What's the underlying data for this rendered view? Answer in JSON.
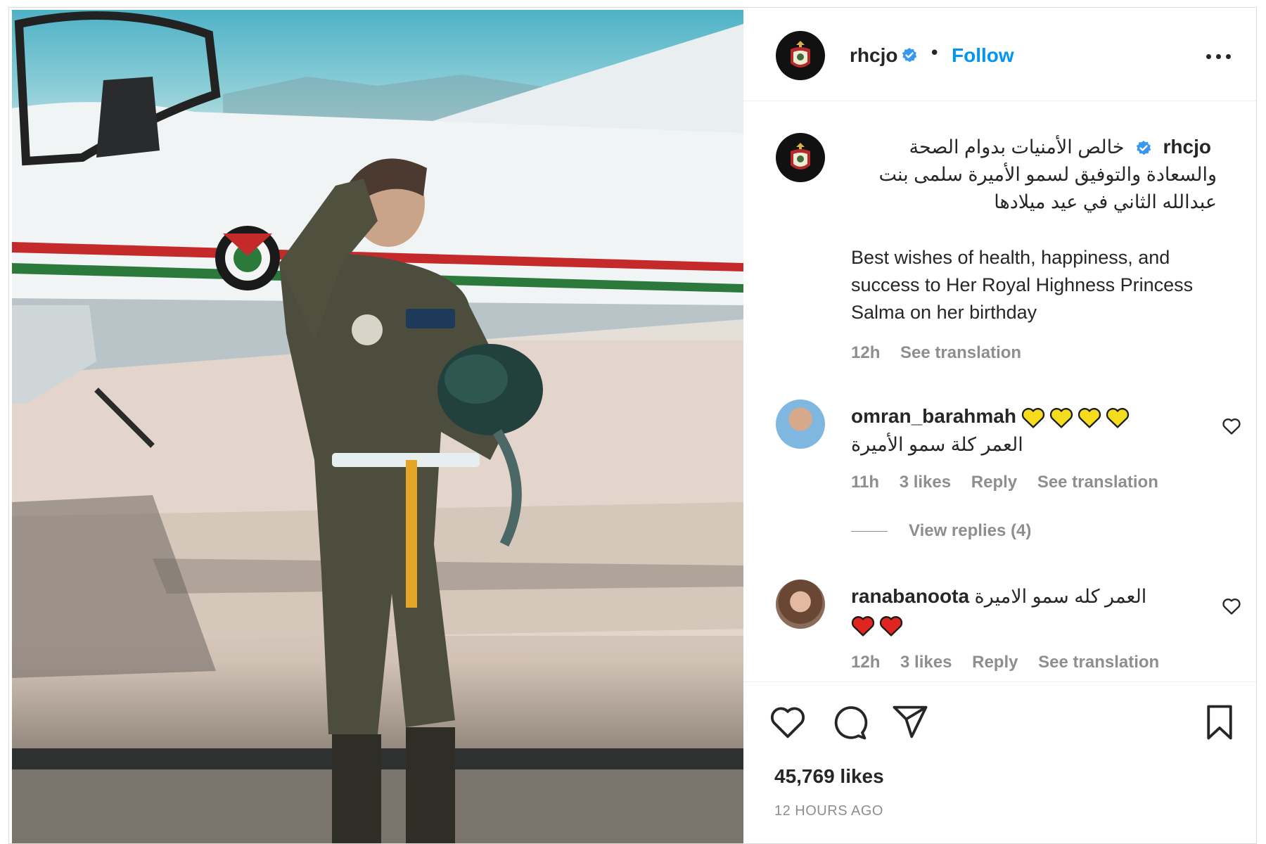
{
  "post": {
    "username": "rhcjo",
    "follow_label": "Follow",
    "separator": "•"
  },
  "caption": {
    "username": "rhcjo",
    "arabic": "خالص الأمنيات بدوام الصحة والسعادة والتوفيق لسمو الأميرة سلمى بنت عبدالله الثاني في عيد ميلادها",
    "english": "Best wishes of health, happiness, and success to Her Royal Highness Princess Salma on her birthday",
    "time": "12h",
    "see_translation": "See translation"
  },
  "comments": [
    {
      "username": "omran_barahmah",
      "text": "العمر كلة سمو الأميرة",
      "emoji_hearts": 4,
      "emoji_color": "#f5dc1f",
      "time": "11h",
      "likes": "3 likes",
      "reply": "Reply",
      "see_translation": "See translation"
    },
    {
      "username": "ranabanoota",
      "text": "العمر كله سمو الاميرة",
      "emoji_hearts": 2,
      "emoji_color": "#e0241f",
      "time": "12h",
      "likes": "3 likes",
      "reply": "Reply",
      "see_translation": "See translation"
    }
  ],
  "view_replies": "View replies (4)",
  "likes_count": "45,769 likes",
  "posted_ago": "12 HOURS AGO",
  "icons": {
    "verified": "verified-badge-icon",
    "more": "more-options-icon",
    "like": "heart-icon",
    "comment": "comment-icon",
    "share": "paper-plane-icon",
    "save": "bookmark-icon"
  },
  "colors": {
    "accent": "#0095f6",
    "text": "#262626",
    "muted": "#8e8e8e",
    "verified": "#3897f0"
  }
}
